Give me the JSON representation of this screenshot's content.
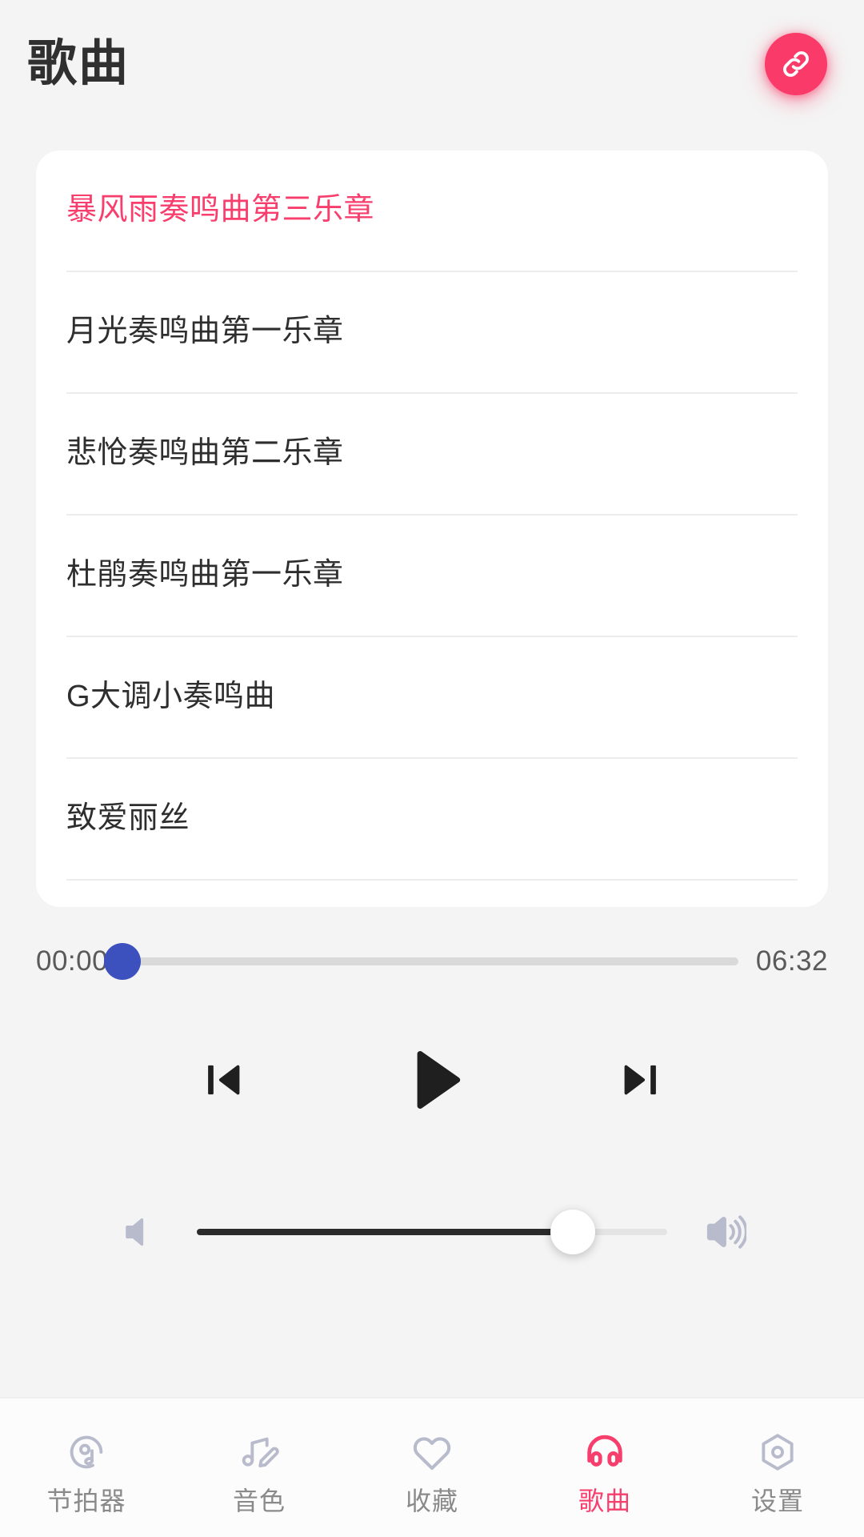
{
  "theme": {
    "accent": "#F73E6C",
    "fab": "#FA3A68",
    "progress_thumb": "#3C51BE",
    "background": "#F4F4F4",
    "card": "#FFFFFF",
    "nav_inactive": "#8A8A8A",
    "icon_inactive": "#B8BBCC"
  },
  "header": {
    "title": "歌曲",
    "link_button_icon": "link-icon"
  },
  "songs": [
    {
      "title": "暴风雨奏鸣曲第三乐章",
      "selected": true
    },
    {
      "title": "月光奏鸣曲第一乐章",
      "selected": false
    },
    {
      "title": "悲怆奏鸣曲第二乐章",
      "selected": false
    },
    {
      "title": "杜鹃奏鸣曲第一乐章",
      "selected": false
    },
    {
      "title": "G大调小奏鸣曲",
      "selected": false
    },
    {
      "title": "致爱丽丝",
      "selected": false
    }
  ],
  "player": {
    "current_time": "00:00",
    "total_time": "06:32",
    "progress_percent": 0,
    "volume_percent": 80,
    "prev_icon": "skip-previous-icon",
    "play_icon": "play-icon",
    "next_icon": "skip-next-icon",
    "volume_mute_icon": "volume-low-icon",
    "volume_high_icon": "volume-high-icon"
  },
  "bottom_nav": {
    "items": [
      {
        "label": "节拍器",
        "icon": "metronome-icon",
        "active": false
      },
      {
        "label": "音色",
        "icon": "note-edit-icon",
        "active": false
      },
      {
        "label": "收藏",
        "icon": "heart-icon",
        "active": false
      },
      {
        "label": "歌曲",
        "icon": "headphones-icon",
        "active": true
      },
      {
        "label": "设置",
        "icon": "settings-hexagon-icon",
        "active": false
      }
    ]
  }
}
